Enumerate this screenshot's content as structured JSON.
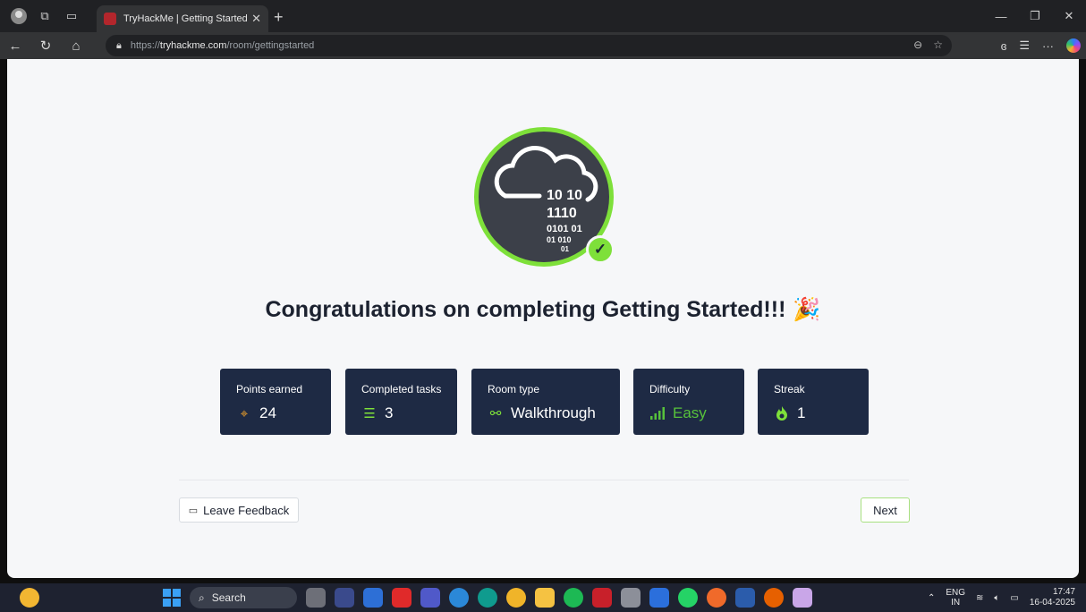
{
  "browser": {
    "tab_title": "TryHackMe | Getting Started",
    "url_prefix": "https://",
    "url_domain": "tryhackme.com",
    "url_path": "/room/gettingstarted"
  },
  "badge": {
    "line1": "10  10",
    "line2": "1110",
    "line3": "0101  01",
    "line4": "01    010",
    "line5": "01"
  },
  "heading": "Congratulations on completing Getting Started!!!",
  "stats": [
    {
      "label": "Points earned",
      "value": "24",
      "icon": "crosshair-icon"
    },
    {
      "label": "Completed tasks",
      "value": "3",
      "icon": "checklist-icon"
    },
    {
      "label": "Room type",
      "value": "Walkthrough",
      "icon": "route-icon"
    },
    {
      "label": "Difficulty",
      "value": "Easy",
      "icon": "signal-bars-icon"
    },
    {
      "label": "Streak",
      "value": "1",
      "icon": "flame-icon"
    }
  ],
  "buttons": {
    "feedback": "Leave Feedback",
    "next": "Next"
  },
  "taskbar": {
    "search": "Search",
    "lang_top": "ENG",
    "lang_bottom": "IN",
    "time": "17:47",
    "date": "16-04-2025"
  },
  "colors": {
    "accent_green": "#7ee03a",
    "card_bg": "#1e2a44",
    "difficulty_easy": "#57c23b",
    "points_icon": "#f0a22a"
  }
}
